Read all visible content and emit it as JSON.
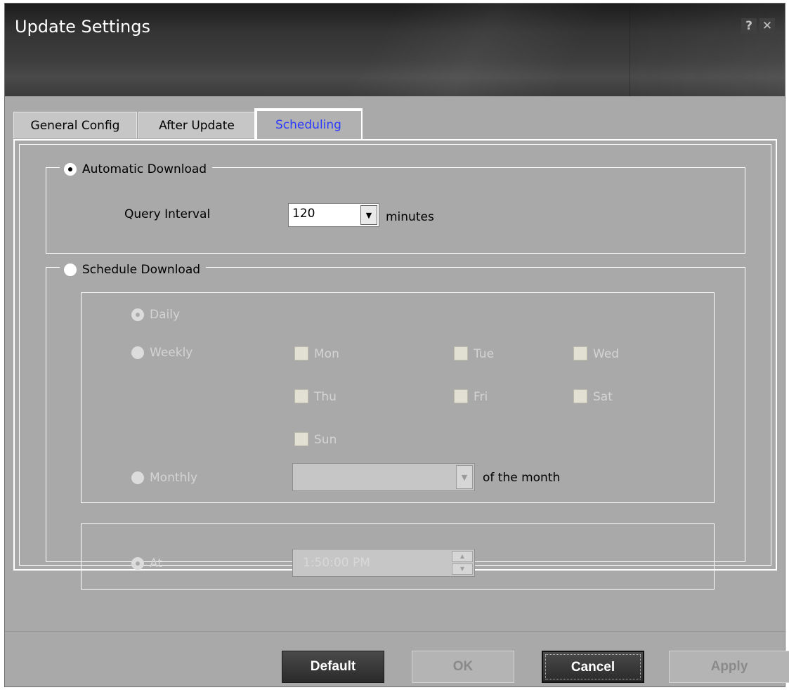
{
  "window": {
    "title": "Update Settings",
    "help_glyph": "?",
    "close_glyph": "✕"
  },
  "tabs": [
    {
      "label": "General Config"
    },
    {
      "label": "After Update"
    },
    {
      "label": "Scheduling"
    }
  ],
  "automatic": {
    "label": "Automatic Download",
    "query_interval_label": "Query Interval",
    "query_interval_value": "120",
    "unit": "minutes"
  },
  "schedule": {
    "label": "Schedule Download",
    "daily_label": "Daily",
    "weekly_label": "Weekly",
    "monthly_label": "Monthly",
    "days": [
      "Mon",
      "Tue",
      "Wed",
      "Thu",
      "Fri",
      "Sat",
      "Sun"
    ],
    "monthly_value": "",
    "monthly_suffix": "of the month",
    "at_label": "At",
    "time_value": "1:50:00 PM"
  },
  "buttons": {
    "default": "Default",
    "ok": "OK",
    "cancel": "Cancel",
    "apply": "Apply"
  }
}
